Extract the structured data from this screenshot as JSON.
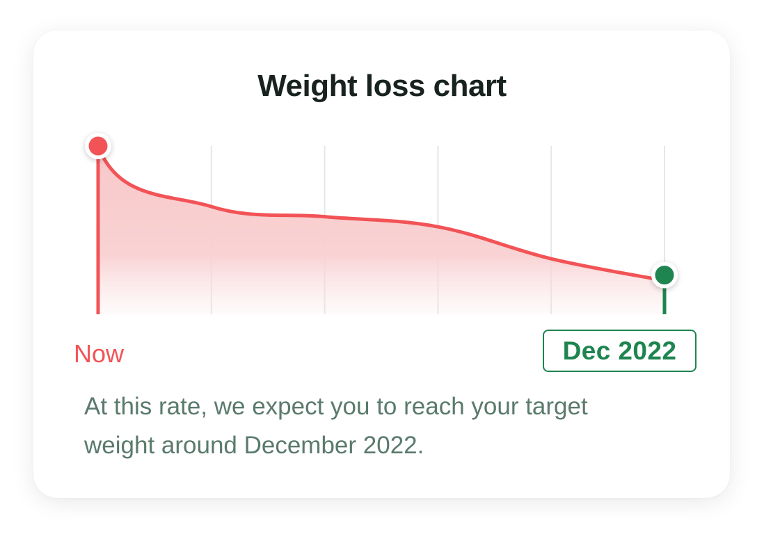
{
  "title": "Weight loss chart",
  "start_label": "Now",
  "end_label": "Dec 2022",
  "description": "At this rate, we expect you to reach your target weight around December 2022.",
  "colors": {
    "start": "#f25356",
    "end": "#1e8450",
    "area_top": "#f8c7c8",
    "gridline": "#e6e6e6",
    "text_muted": "#5a7a6c"
  },
  "chart_data": {
    "type": "area",
    "title": "Weight loss chart",
    "x": [
      0,
      1,
      2,
      3,
      4,
      5
    ],
    "y": [
      1.0,
      0.64,
      0.58,
      0.52,
      0.33,
      0.2
    ],
    "ylim": [
      0,
      1
    ],
    "grid": true,
    "markers": [
      {
        "label": "Now",
        "color": "#f25356"
      },
      {
        "label": "Dec 2022",
        "color": "#1e8450"
      }
    ]
  }
}
